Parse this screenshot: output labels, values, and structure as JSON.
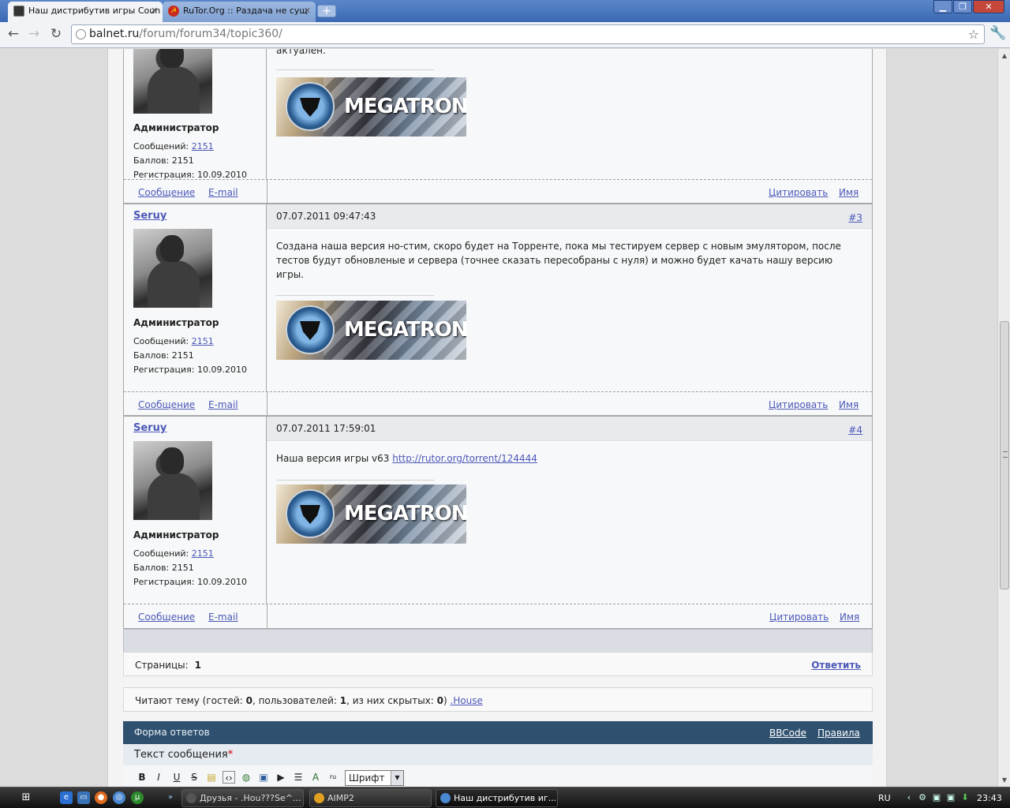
{
  "browser": {
    "tabs": [
      {
        "label": "Наш дистрибутив игры Coun"
      },
      {
        "label": "RuTor.Org :: Раздача не сущ"
      }
    ],
    "url_host": "balnet.ru",
    "url_path": "/forum/forum34/topic360/"
  },
  "top_post": {
    "text_tail": "актуален.",
    "role": "Администратор",
    "posts_label": "Сообщений: ",
    "posts_count": "2151",
    "points": "Баллов: 2151",
    "registration": "Регистрация: 10.09.2010",
    "footer": {
      "message": "Сообщение",
      "email": "E-mail",
      "quote": "Цитировать",
      "name": "Имя"
    }
  },
  "posts": [
    {
      "author": "Seruy",
      "role": "Администратор",
      "posts_label": "Сообщений: ",
      "posts_count": "2151",
      "points": "Баллов: 2151",
      "registration": "Регистрация: 10.09.2010",
      "date": "07.07.2011 09:47:43",
      "number": "#3",
      "text": "Создана наша версия но-стим, скоро будет на Торренте, пока мы тестируем сервер с новым эмулятором, после тестов будут обновленые и сервера (точнее сказать пересобраны с нуля) и можно будет качать нашу версию игры.",
      "signature_text": "MEGATRON",
      "footer": {
        "message": "Сообщение",
        "email": "E-mail",
        "quote": "Цитировать",
        "name": "Имя"
      }
    },
    {
      "author": "Seruy",
      "role": "Администратор",
      "posts_label": "Сообщений: ",
      "posts_count": "2151",
      "points": "Баллов: 2151",
      "registration": "Регистрация: 10.09.2010",
      "date": "07.07.2011 17:59:01",
      "number": "#4",
      "text": "Наша версия игры v63 ",
      "link": "http://rutor.org/torrent/124444",
      "signature_text": "MEGATRON",
      "footer": {
        "message": "Сообщение",
        "email": "E-mail",
        "quote": "Цитировать",
        "name": "Имя"
      }
    }
  ],
  "signature_text": "MEGATRON",
  "pages": {
    "label": "Страницы:",
    "current": "1",
    "reply": "Ответить"
  },
  "readers": {
    "prefix": "Читают тему (гостей: ",
    "guests": "0",
    "mid1": ", пользователей: ",
    "users": "1",
    "mid2": ", из них скрытых: ",
    "hidden": "0",
    "suffix": ") ",
    "user_link": ".House"
  },
  "reply_form": {
    "title": "Форма ответов",
    "bbcode": "BBCode",
    "rules": "Правила",
    "message_label": "Текст сообщения",
    "required_mark": "*",
    "font_select": "Шрифт"
  },
  "editor_buttons": [
    "B",
    "I",
    "U",
    "S"
  ],
  "taskbar": {
    "buttons": [
      {
        "label": "Друзья - .Hou???Se^..."
      },
      {
        "label": "AIMP2"
      },
      {
        "label": "Наш дистрибутив иг..."
      }
    ],
    "lang": "RU",
    "time": "23:43"
  },
  "colors": {
    "link": "#4b58b8",
    "form_header": "#2f516f",
    "required": "#cc0000"
  }
}
